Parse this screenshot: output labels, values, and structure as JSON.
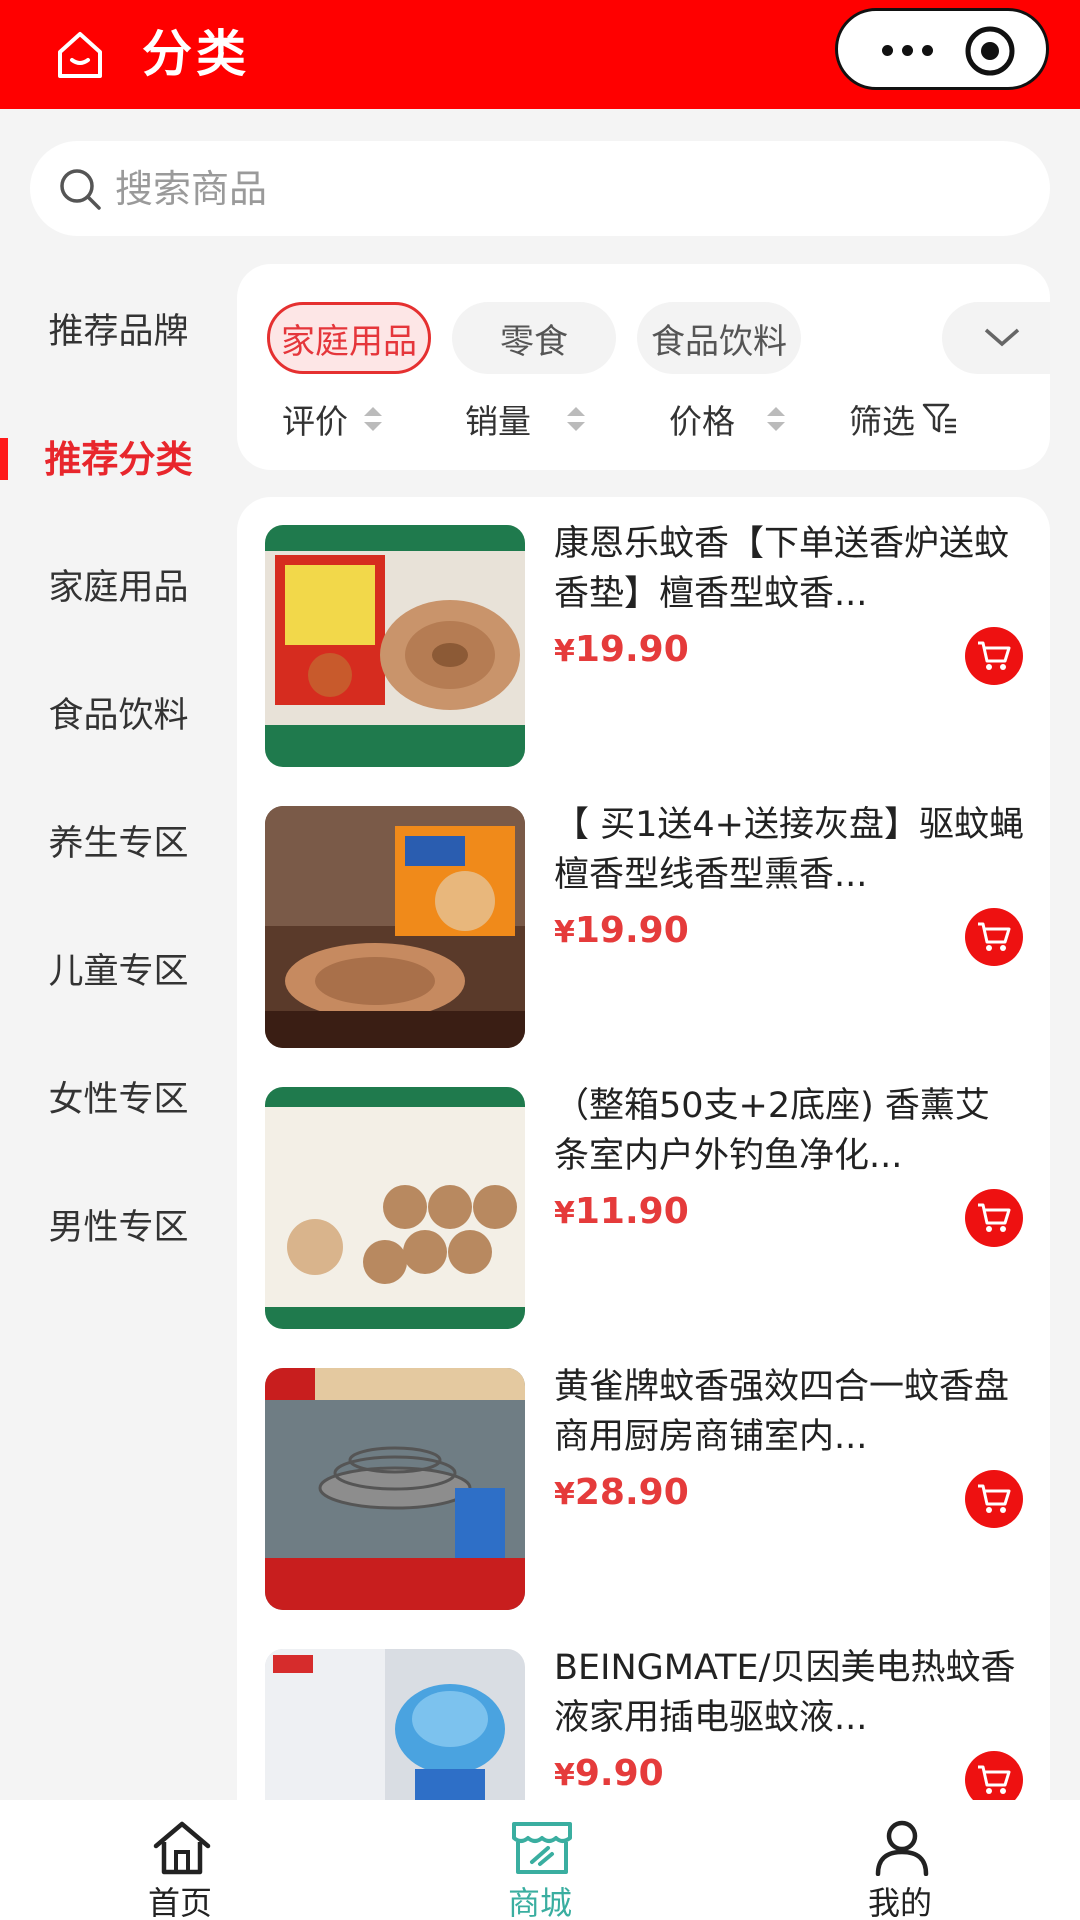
{
  "header": {
    "title": "分类",
    "home_icon": "home-icon",
    "more_icon": "more-dots-icon",
    "target_icon": "target-icon",
    "color": "#ff0000"
  },
  "search": {
    "placeholder": "搜索商品"
  },
  "sidebar": {
    "items": [
      {
        "label": "推荐品牌",
        "active": false
      },
      {
        "label": "推荐分类",
        "active": true
      },
      {
        "label": "家庭用品",
        "active": false
      },
      {
        "label": "食品饮料",
        "active": false
      },
      {
        "label": "养生专区",
        "active": false
      },
      {
        "label": "儿童专区",
        "active": false
      },
      {
        "label": "女性专区",
        "active": false
      },
      {
        "label": "男性专区",
        "active": false
      }
    ]
  },
  "filters": {
    "chips": [
      {
        "label": "家庭用品",
        "active": true
      },
      {
        "label": "零食",
        "active": false
      },
      {
        "label": "食品饮料",
        "active": false
      }
    ],
    "sort": [
      {
        "label": "评价"
      },
      {
        "label": "销量"
      },
      {
        "label": "价格"
      },
      {
        "label": "筛选"
      }
    ]
  },
  "products": [
    {
      "title": "康恩乐蚊香【下单送香炉送蚊香垫】檀香型蚊香...",
      "price": "19.90",
      "currency": "¥"
    },
    {
      "title": "【 买1送4+送接灰盘】驱蚊蝇檀香型线香型熏香...",
      "price": "19.90",
      "currency": "¥"
    },
    {
      "title": "（整箱50支+2底座) 香薰艾条室内户外钓鱼净化...",
      "price": "11.90",
      "currency": "¥"
    },
    {
      "title": "黄雀牌蚊香强效四合一蚊香盘商用厨房商铺室内...",
      "price": "28.90",
      "currency": "¥"
    },
    {
      "title": "BEINGMATE/贝因美电热蚊香液家用插电驱蚊液...",
      "price": "9.90",
      "currency": "¥"
    }
  ],
  "tabbar": {
    "items": [
      {
        "label": "首页",
        "icon": "home-icon",
        "active": false
      },
      {
        "label": "商城",
        "icon": "store-icon",
        "active": true
      },
      {
        "label": "我的",
        "icon": "user-icon",
        "active": false
      }
    ]
  },
  "colors": {
    "accent": "#ff0000",
    "price": "#e53b3b",
    "active_tab": "#3aaea0"
  }
}
